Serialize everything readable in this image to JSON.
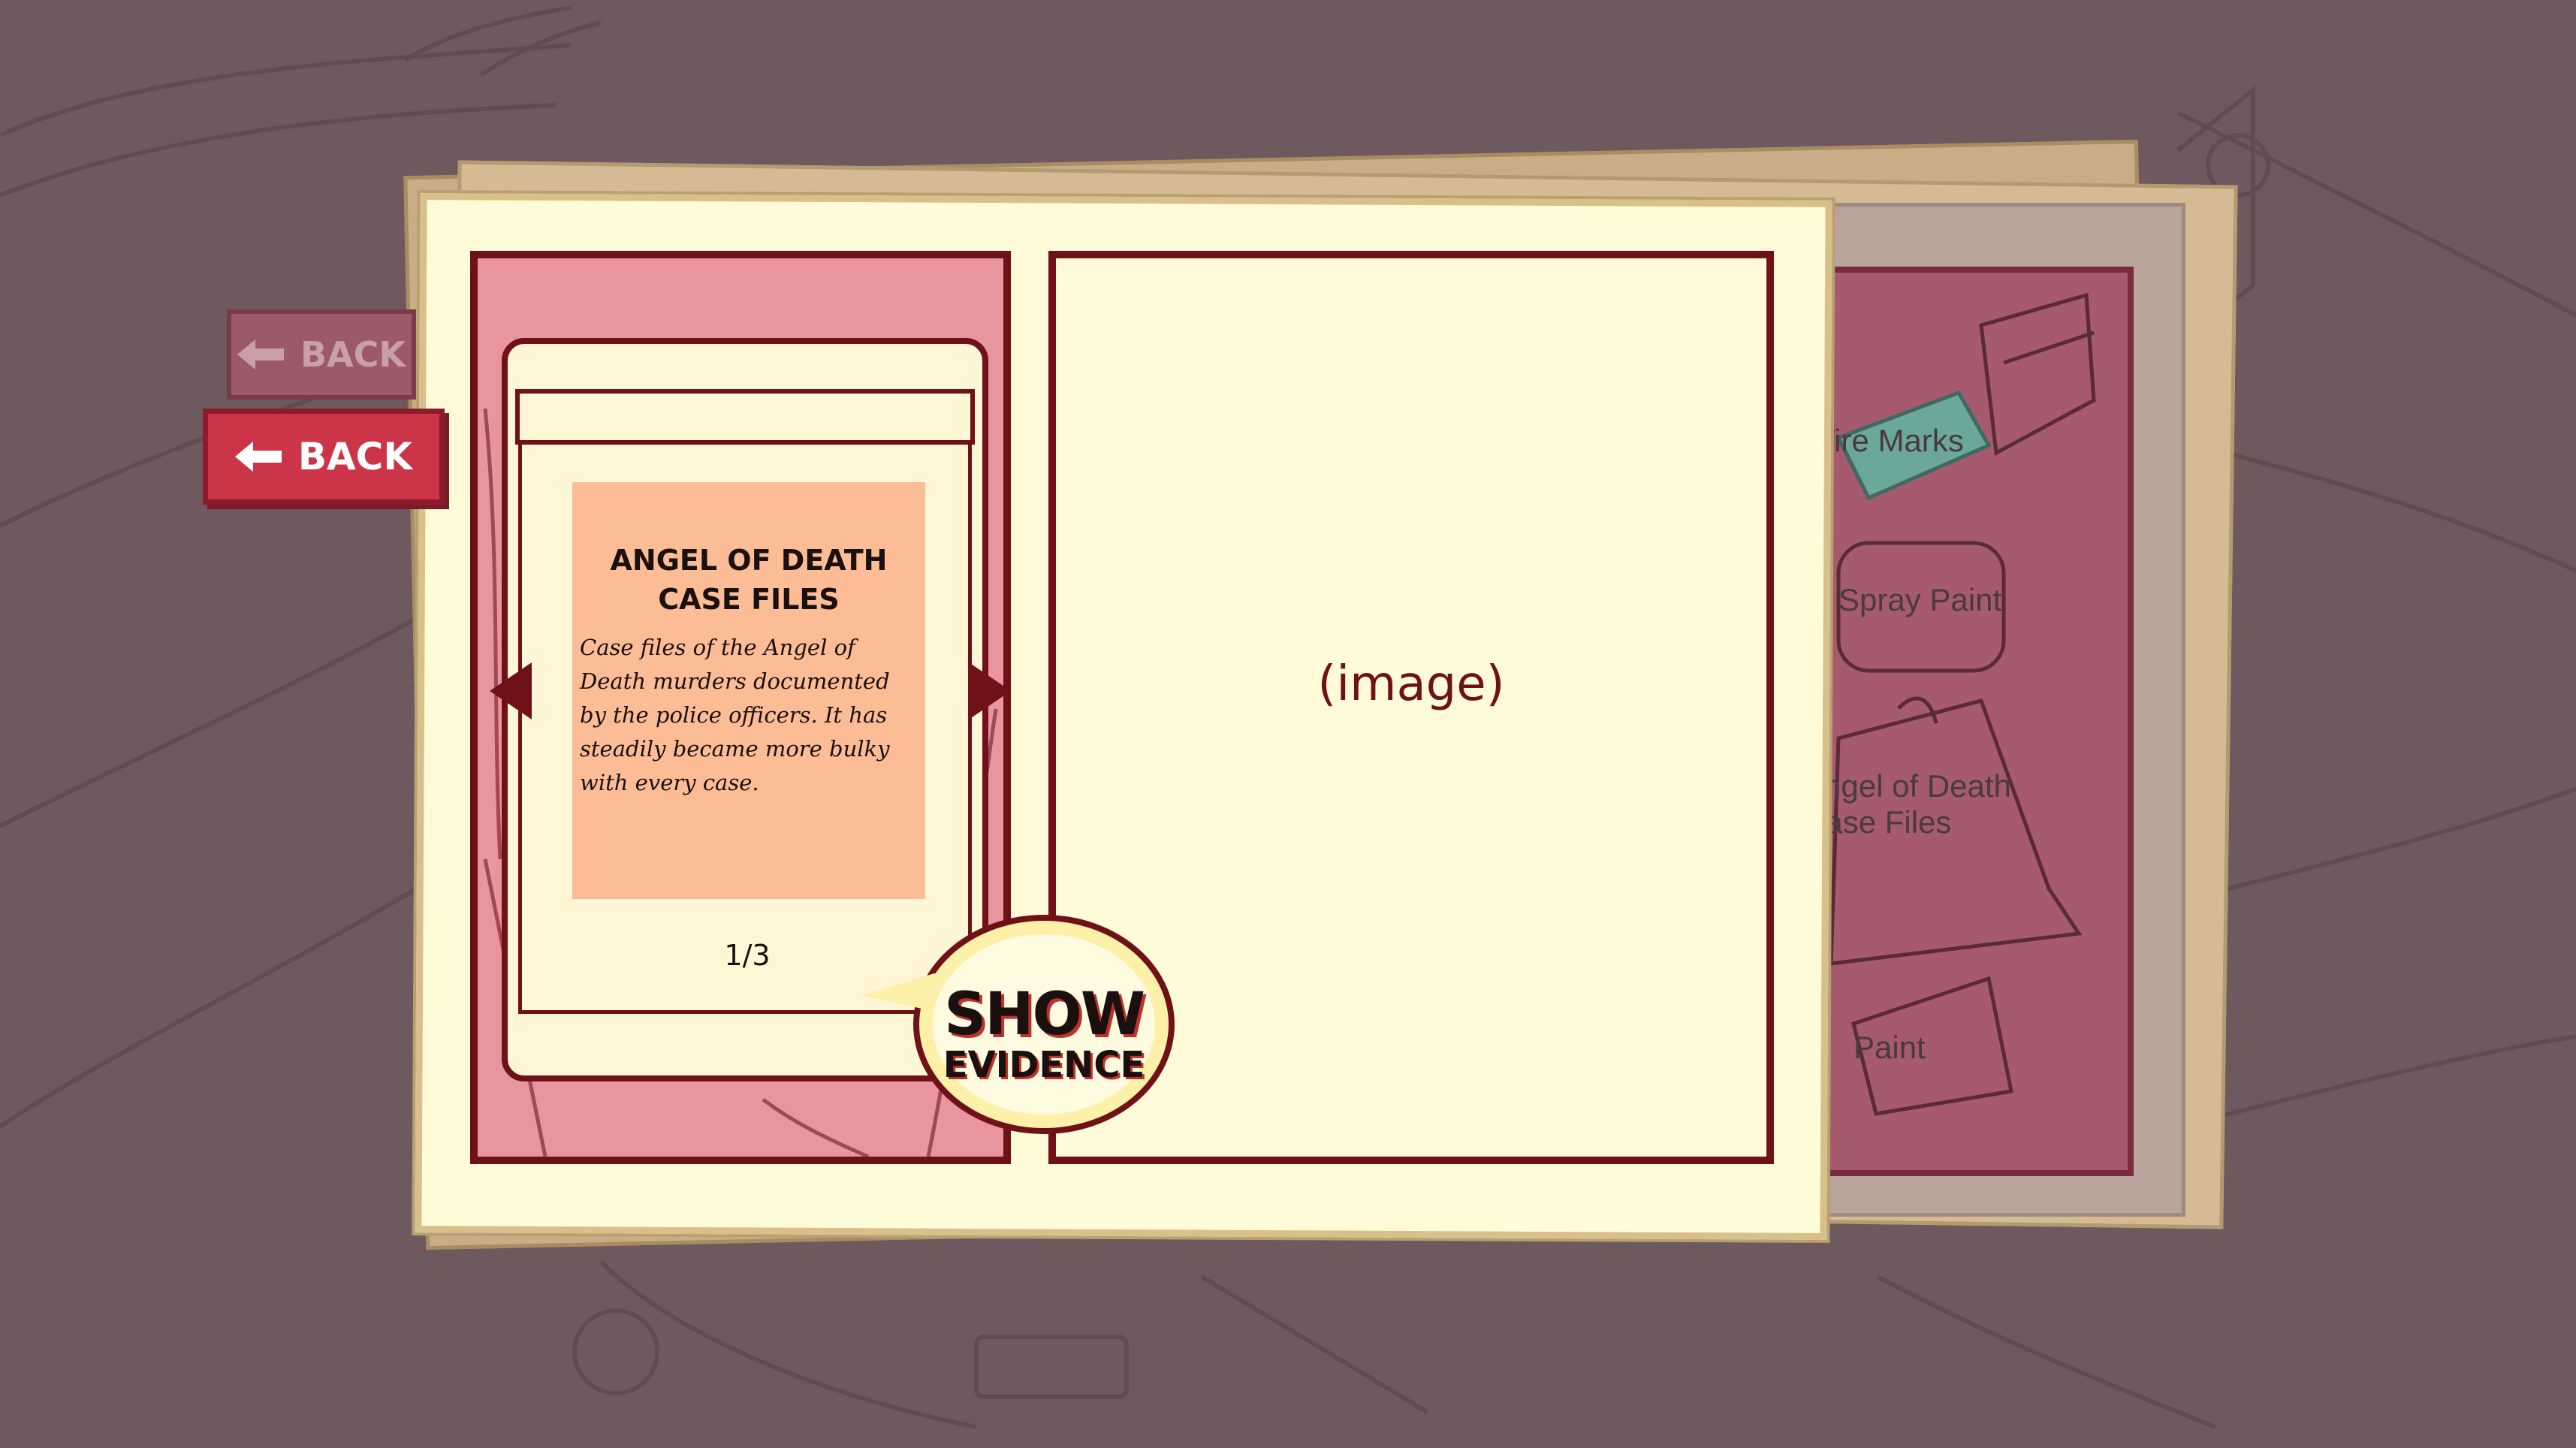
{
  "buttons": {
    "back_faded_label": "BACK",
    "back_main_label": "BACK"
  },
  "evidence_card": {
    "title_line1": "ANGEL OF DEATH",
    "title_line2": "CASE FILES",
    "description": "Case files of the Angel of Death murders documented by the police officers. It has steadily became more bulky with every case.",
    "page_indicator": "1/3"
  },
  "show_evidence": {
    "line1": "SHOW",
    "line2": "EVIDENCE"
  },
  "detail_panel": {
    "image_placeholder": "(image)"
  },
  "evidence_list": {
    "items": [
      {
        "label": "Tire Marks"
      },
      {
        "label": "Spray Paint"
      },
      {
        "label_line1": "Angel of Death",
        "label_line2": "Case Files"
      },
      {
        "label": "Paint"
      }
    ]
  },
  "colors": {
    "background": "#6e5a5e",
    "page_pink": "#e8959f",
    "border_maroon": "#6e1218",
    "card_peach": "#fbbc96",
    "notebook_cream": "#fffbd8",
    "back_button_red": "#cc3548"
  }
}
